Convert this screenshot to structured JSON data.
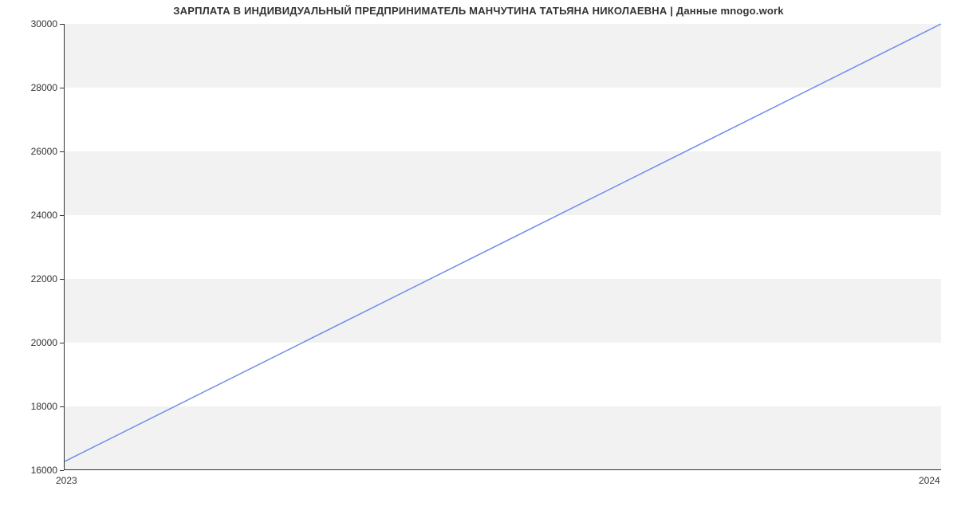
{
  "chart_data": {
    "type": "line",
    "title": "ЗАРПЛАТА В ИНДИВИДУАЛЬНЫЙ ПРЕДПРИНИМАТЕЛЬ МАНЧУТИНА ТАТЬЯНА НИКОЛАЕВНА | Данные mnogo.work",
    "xlabel": "",
    "ylabel": "",
    "x_ticks": [
      "2023",
      "2024"
    ],
    "y_ticks": [
      16000,
      18000,
      20000,
      22000,
      24000,
      26000,
      28000,
      30000
    ],
    "ylim": [
      16000,
      30000
    ],
    "xlim": [
      "2023",
      "2024"
    ],
    "grid": "alternating-bands",
    "series": [
      {
        "name": "salary",
        "x": [
          "2023",
          "2024"
        ],
        "values": [
          16250,
          30000
        ]
      }
    ]
  },
  "colors": {
    "line": "#6f8ee8",
    "band": "#f2f2f2",
    "axis": "#333333"
  }
}
